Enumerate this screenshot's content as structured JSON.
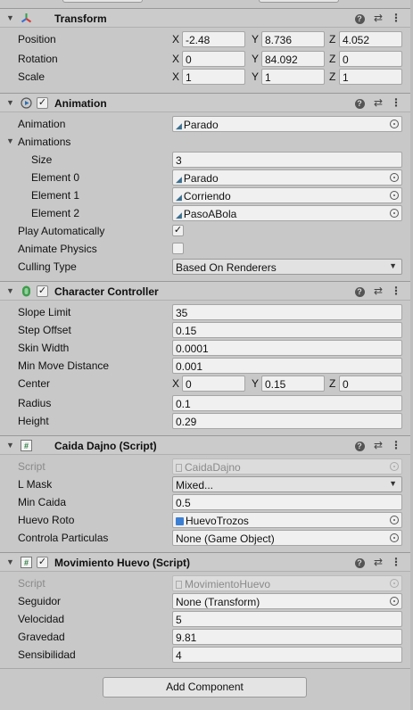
{
  "transform": {
    "title": "Transform",
    "position": {
      "label": "Position",
      "x": "-2.48",
      "y": "8.736",
      "z": "4.052"
    },
    "rotation": {
      "label": "Rotation",
      "x": "0",
      "y": "84.092",
      "z": "0"
    },
    "scale": {
      "label": "Scale",
      "x": "1",
      "y": "1",
      "z": "1"
    }
  },
  "axes": {
    "x": "X",
    "y": "Y",
    "z": "Z"
  },
  "animation": {
    "title": "Animation",
    "enabled": "✓",
    "animation_label": "Animation",
    "animation_value": "Parado",
    "animations_label": "Animations",
    "size_label": "Size",
    "size_value": "3",
    "elements": [
      {
        "label": "Element 0",
        "value": "Parado"
      },
      {
        "label": "Element 1",
        "value": "Corriendo"
      },
      {
        "label": "Element 2",
        "value": "PasoABola"
      }
    ],
    "play_auto_label": "Play Automatically",
    "play_auto_value": "✓",
    "animate_physics_label": "Animate Physics",
    "animate_physics_value": "",
    "culling_label": "Culling Type",
    "culling_value": "Based On Renderers"
  },
  "character_controller": {
    "title": "Character Controller",
    "enabled": "✓",
    "slope_limit": {
      "label": "Slope Limit",
      "value": "35"
    },
    "step_offset": {
      "label": "Step Offset",
      "value": "0.15"
    },
    "skin_width": {
      "label": "Skin Width",
      "value": "0.0001"
    },
    "min_move": {
      "label": "Min Move Distance",
      "value": "0.001"
    },
    "center": {
      "label": "Center",
      "x": "0",
      "y": "0.15",
      "z": "0"
    },
    "radius": {
      "label": "Radius",
      "value": "0.1"
    },
    "height": {
      "label": "Height",
      "value": "0.29"
    }
  },
  "caida": {
    "title": "Caida Dajno (Script)",
    "script_label": "Script",
    "script_value": "CaidaDajno",
    "lmask_label": "L Mask",
    "lmask_value": "Mixed...",
    "min_caida_label": "Min Caida",
    "min_caida_value": "0.5",
    "huevo_roto_label": "Huevo Roto",
    "huevo_roto_value": "HuevoTrozos",
    "controla_label": "Controla Particulas",
    "controla_value": "None (Game Object)"
  },
  "movimiento": {
    "title": "Movimiento Huevo (Script)",
    "enabled": "✓",
    "script_label": "Script",
    "script_value": "MovimientoHuevo",
    "seguidor_label": "Seguidor",
    "seguidor_value": "None (Transform)",
    "velocidad_label": "Velocidad",
    "velocidad_value": "5",
    "gravedad_label": "Gravedad",
    "gravedad_value": "9.81",
    "sensibilidad_label": "Sensibilidad",
    "sensibilidad_value": "4"
  },
  "add_component_label": "Add Component",
  "header_icons": {
    "help": "?",
    "presets": "⇄",
    "menu": "⋮",
    "fold": "▼"
  }
}
